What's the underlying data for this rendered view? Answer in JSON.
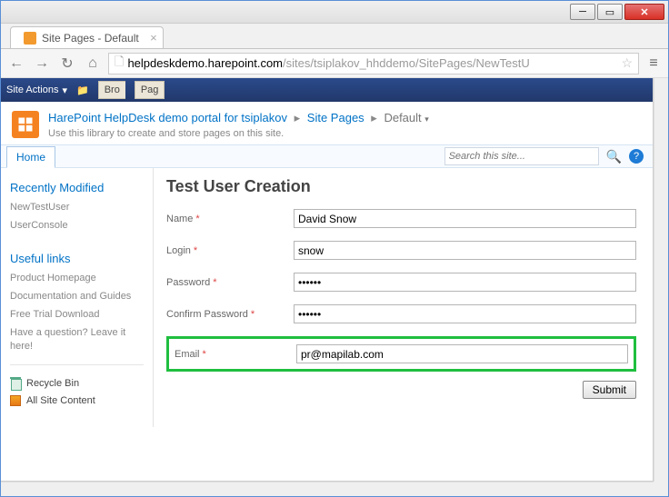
{
  "window": {
    "tab_title": "Site Pages - Default"
  },
  "browser": {
    "url_domain": "helpdeskdemo.harepoint.com",
    "url_rest": "/sites/tsiplakov_hhddemo/SitePages/NewTestU"
  },
  "ribbon": {
    "site_actions": "Site Actions",
    "browse": "Bro",
    "page": "Pag"
  },
  "header": {
    "breadcrumb_root": "HarePoint HelpDesk demo portal for tsiplakov",
    "breadcrumb_mid": "Site Pages",
    "breadcrumb_cur": "Default",
    "subtitle": "Use this library to create and store pages on this site."
  },
  "hometab": "Home",
  "search": {
    "placeholder": "Search this site..."
  },
  "sidebar": {
    "recently_modified_title": "Recently Modified",
    "recent": [
      "NewTestUser",
      "UserConsole"
    ],
    "useful_title": "Useful links",
    "useful": [
      "Product Homepage",
      "Documentation and Guides",
      "Free Trial Download",
      "Have a question? Leave it here!"
    ],
    "recycle": "Recycle Bin",
    "all_content": "All Site Content"
  },
  "form": {
    "title": "Test User Creation",
    "name_label": "Name",
    "name_value": "David Snow",
    "login_label": "Login",
    "login_value": "snow",
    "password_label": "Password",
    "password_value": "••••••",
    "confirm_label": "Confirm Password",
    "confirm_value": "••••••",
    "email_label": "Email",
    "email_value": "pr@mapilab.com",
    "submit": "Submit"
  }
}
